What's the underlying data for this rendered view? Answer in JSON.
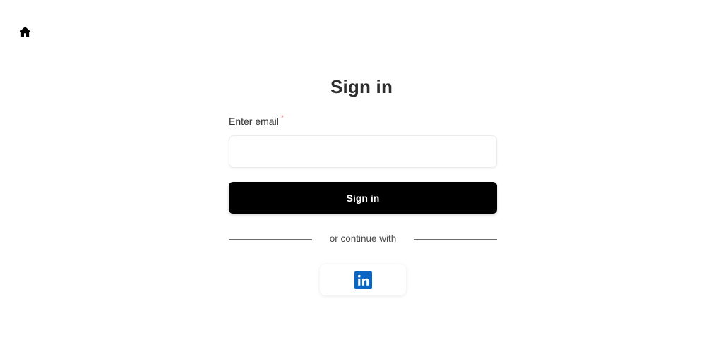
{
  "header": {
    "home_icon": "home-icon"
  },
  "page": {
    "title": "Sign in"
  },
  "form": {
    "email_label": "Enter email",
    "required_mark": "*",
    "email_value": "",
    "email_placeholder": "",
    "submit_label": "Sign in"
  },
  "social": {
    "divider_text": "or continue with",
    "providers": [
      {
        "name": "LinkedIn",
        "icon": "linkedin-icon",
        "color": "#0A66C2"
      }
    ]
  },
  "colors": {
    "primary_button": "#000000",
    "required": "#D84B4B",
    "linkedin": "#0A66C2"
  }
}
